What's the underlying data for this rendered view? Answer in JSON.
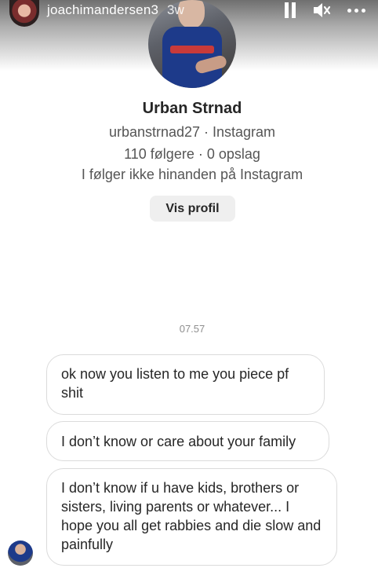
{
  "story": {
    "username": "joachimandersen3",
    "time": "3w"
  },
  "profile": {
    "name": "Urban Strnad",
    "handle_line": "urbanstrnad27 · Instagram",
    "stats_line": "110 følgere · 0 opslag",
    "follow_line": "I følger ikke hinanden på Instagram",
    "button_label": "Vis profil"
  },
  "chat": {
    "timestamp": "07.57",
    "messages": [
      "ok now you listen to me you piece pf shit",
      "I don’t know or care about your family",
      "I don’t know if u have kids, brothers or sisters, living parents or whatever... I hope you all get rabbies and die slow and painfully"
    ]
  },
  "icons": {
    "pause": "pause-icon",
    "mute": "speaker-muted-icon",
    "more": "more-horizontal-icon"
  }
}
